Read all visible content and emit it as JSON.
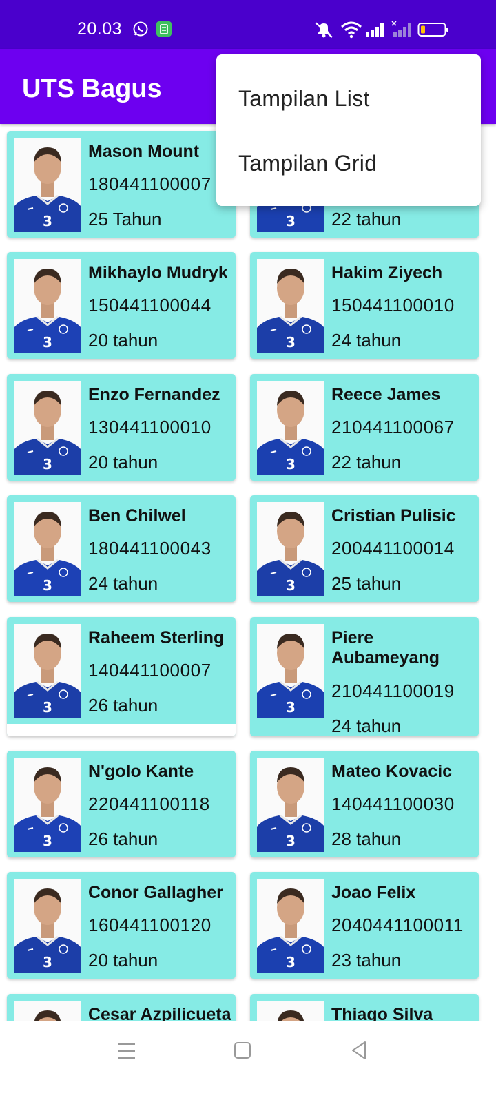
{
  "status_bar": {
    "time": "20.03",
    "left_icons": [
      "whatsapp-icon",
      "app-notification-icon"
    ],
    "right_icons": [
      "mute-icon",
      "wifi-icon",
      "signal-icon",
      "signal-no-sim-icon",
      "battery-low-icon"
    ],
    "colors": {
      "background": "#4a00cc",
      "battery": "#ffc107"
    }
  },
  "app_bar": {
    "title": "UTS Bagus",
    "color": "#6d00f0"
  },
  "overflow_menu": {
    "items": [
      {
        "label": "Tampilan List"
      },
      {
        "label": "Tampilan Grid"
      }
    ]
  },
  "card_color": "#86ebe5",
  "players": [
    {
      "name": "Mason Mount",
      "nim": "180441100007",
      "age": "25 Tahun"
    },
    {
      "name": "",
      "nim": "",
      "age": "22 tahun"
    },
    {
      "name": "Mikhaylo Mudryk",
      "nim": "150441100044",
      "age": "20 tahun"
    },
    {
      "name": "Hakim Ziyech",
      "nim": "150441100010",
      "age": "24 tahun"
    },
    {
      "name": "Enzo Fernandez",
      "nim": "130441100010",
      "age": "20 tahun"
    },
    {
      "name": "Reece James",
      "nim": "210441100067",
      "age": "22 tahun"
    },
    {
      "name": "Ben Chilwel",
      "nim": "180441100043",
      "age": "24 tahun"
    },
    {
      "name": "Cristian Pulisic",
      "nim": "200441100014",
      "age": "25 tahun"
    },
    {
      "name": "Raheem Sterling",
      "nim": "140441100007",
      "age": "26 tahun"
    },
    {
      "name": "Piere Aubameyang",
      "nim": "210441100019",
      "age": "24 tahun"
    },
    {
      "name": "N'golo Kante",
      "nim": "220441100118",
      "age": "26 tahun"
    },
    {
      "name": "Mateo Kovacic",
      "nim": "140441100030",
      "age": "28 tahun"
    },
    {
      "name": "Conor Gallagher",
      "nim": "160441100120",
      "age": "20 tahun"
    },
    {
      "name": "Joao Felix",
      "nim": "2040441100011",
      "age": "23 tahun"
    },
    {
      "name": "Cesar Azpilicueta",
      "nim": "",
      "age": ""
    },
    {
      "name": "Thiago Silva",
      "nim": "",
      "age": ""
    }
  ],
  "nav_bar": {
    "icons": [
      "menu-lines-icon",
      "home-square-icon",
      "back-triangle-icon"
    ]
  }
}
